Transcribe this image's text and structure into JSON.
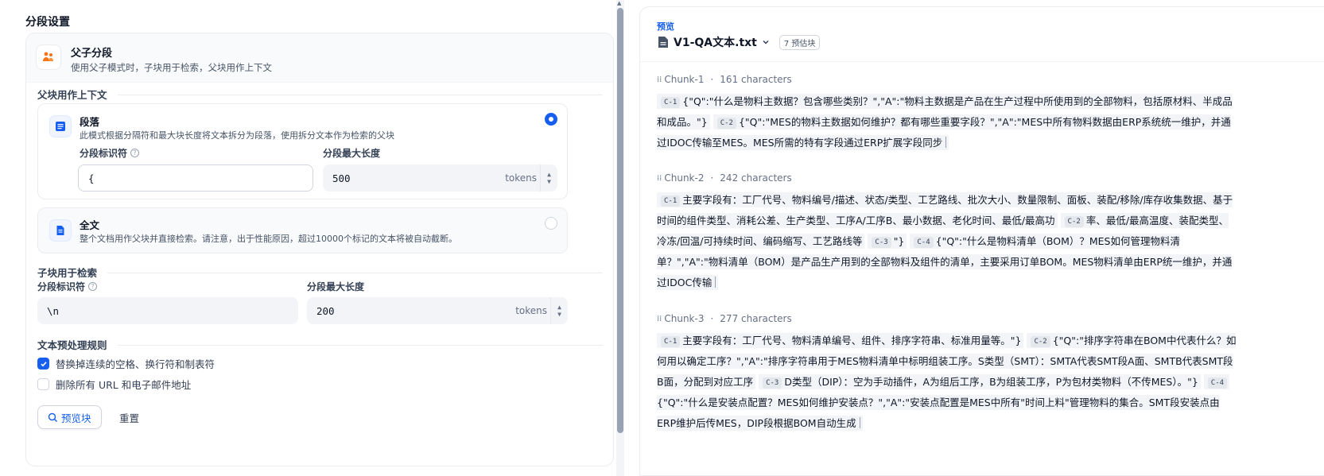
{
  "left": {
    "section_title": "分段设置",
    "mode_title": "父子分段",
    "mode_desc": "使用父子模式时，子块用于检索，父块用作上下文",
    "parent_label": "父块用作上下文",
    "paragraph": {
      "title": "段落",
      "desc": "此模式根据分隔符和最大块长度将文本拆分为段落，使用拆分文本作为检索的父块",
      "delimiter_label": "分段标识符",
      "delimiter_value": "{",
      "maxlen_label": "分段最大长度",
      "maxlen_value": "500",
      "unit": "tokens"
    },
    "fulltext": {
      "title": "全文",
      "desc": "整个文档用作父块并直接检索。请注意，出于性能原因，超过10000个标记的文本将被自动截断。"
    },
    "child_label": "子块用于检索",
    "child": {
      "delimiter_label": "分段标识符",
      "delimiter_value": "\\n",
      "maxlen_label": "分段最大长度",
      "maxlen_value": "200",
      "unit": "tokens"
    },
    "preprocess_label": "文本预处理规则",
    "rules": [
      {
        "label": "替换掉连续的空格、换行符和制表符",
        "checked": true
      },
      {
        "label": "删除所有 URL 和电子邮件地址",
        "checked": false
      }
    ],
    "preview_button": "预览块",
    "reset_button": "重置"
  },
  "right": {
    "preview_tag": "预览",
    "file_name": "V1-QA文本.txt",
    "chunk_count": "7 预估块",
    "chunks": [
      {
        "name": "Chunk-1",
        "sep": "·",
        "chars": "161 characters",
        "segments": [
          {
            "tag": "C-1",
            "text": "{\"Q\":\"什么是物料主数据？包含哪些类别？\",\"A\":\"物料主数据是产品在生产过程中所使用到的全部物料，包括原材料、半成品和成品。\"}"
          },
          {
            "tag": "C-2",
            "text": "{\"Q\":\"MES的物料主数据如何维护？都有哪些重要字段？\",\"A\":\"MES中所有物料数据由ERP系统统一维护，并通过IDOC传输至MES。MES所需的特有字段通过ERP扩展字段同步"
          }
        ]
      },
      {
        "name": "Chunk-2",
        "sep": "·",
        "chars": "242 characters",
        "segments": [
          {
            "tag": "C-1",
            "text": "主要字段有：工厂代号、物料编号/描述、状态/类型、工艺路线、批次大小、数量限制、面板、装配/移除/库存收集数据、基于时间的组件类型、消耗公差、生产类型、工序A/工序B、最小数据、老化时间、最低/最高功"
          },
          {
            "tag": "C-2",
            "text": "率、最低/最高温度、装配类型、冷冻/回温/可持续时间、编码缩写、工艺路线等"
          },
          {
            "tag": "C-3",
            "text": "\"}"
          },
          {
            "tag": "C-4",
            "text": "{\"Q\":\"什么是物料清单（BOM）？MES如何管理物料清单？\",\"A\":\"物料清单（BOM）是产品生产用到的全部物料及组件的清单，主要采用订单BOM。MES物料清单由ERP统一维护，并通过IDOC传输"
          }
        ]
      },
      {
        "name": "Chunk-3",
        "sep": "·",
        "chars": "277 characters",
        "segments": [
          {
            "tag": "C-1",
            "text": "主要字段有：工厂代号、物料清单编号、组件、排序字符串、标准用量等。\"}"
          },
          {
            "tag": "C-2",
            "text": "{\"Q\":\"排序字符串在BOM中代表什么？如何用以确定工序？\",\"A\":\"排序字符串用于MES物料清单中标明组装工序。S类型（SMT）：SMTA代表SMT段A面、SMTB代表SMT段B面，分配到对应工序"
          },
          {
            "tag": "C-3",
            "text": "D类型（DIP）：空为手动插件，A为组后工序，B为组装工序，P为包材类物料（不传MES）。\"}"
          },
          {
            "tag": "C-4",
            "text": "{\"Q\":\"什么是安装点配置？MES如何维护安装点？\",\"A\":\"安装点配置是MES中所有\"时间上料\"管理物料的集合。SMT段安装点由ERP维护后传MES，DIP段根据BOM自动生成"
          }
        ]
      }
    ]
  },
  "colors": {
    "accent": "#155eef",
    "chip_bg": "#f2f4f7",
    "icon_orange": "#f97316"
  }
}
